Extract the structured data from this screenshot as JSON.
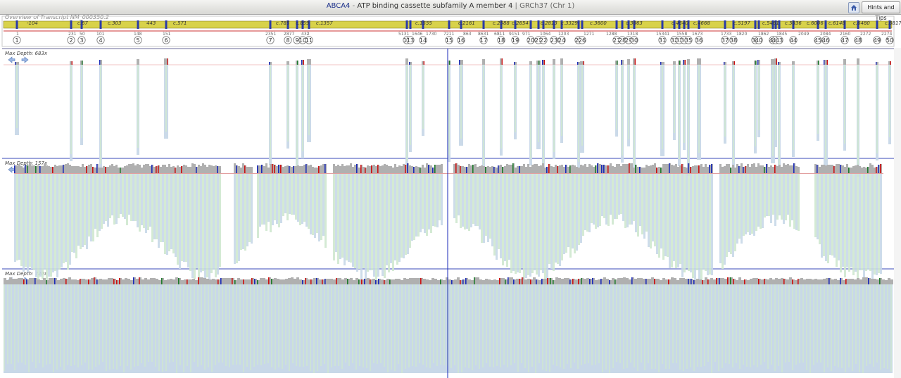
{
  "header": {
    "gene_symbol": "ABCA4",
    "gene_separator": " - ",
    "gene_name": "ATP binding cassette subfamily A member 4",
    "divider": " | ",
    "genome_build": "GRCh37 (Chr 1)",
    "hints_label": "Hints and Tips",
    "home_icon": "home-icon"
  },
  "overview": {
    "label": "Overview of Transcript NM_000350.2",
    "cdna_labels": [
      "-104",
      "c.67",
      "c.303",
      "443",
      "c.571",
      "c.785",
      "c.859",
      "c.1357",
      "c.1555",
      "c.2161",
      "c.2588",
      "c.2654",
      "c.2813",
      "c.3329",
      "c.3600",
      "c.3863",
      "c.4540",
      "c.4668",
      "c.5197",
      "c.5461",
      "c.5836",
      "c.6006",
      "c.6148",
      "c.6480",
      "c.6817"
    ],
    "coord_labels": [
      "1",
      "231",
      "50",
      "101",
      "148",
      "151",
      "2351",
      "2877",
      "432",
      "1",
      "5131",
      "1646",
      "1730",
      "7211",
      "863",
      "8631",
      "6811",
      "9151",
      "971",
      "1064",
      "1203",
      "1271",
      "1288",
      "1318",
      "15341",
      "1558",
      "1673",
      "1733",
      "1820",
      "1862",
      "1845",
      "2049",
      "2084",
      "2160",
      "2272",
      "2274"
    ],
    "exons": [
      "1",
      "2",
      "3",
      "4",
      "5",
      "6",
      "7",
      "8",
      "9",
      "10",
      "11",
      "12",
      "13",
      "14",
      "15",
      "16",
      "17",
      "18",
      "19",
      "20",
      "21",
      "22",
      "23",
      "24",
      "25",
      "26",
      "27",
      "28",
      "29",
      "30",
      "31",
      "32",
      "33",
      "34",
      "35",
      "36",
      "37",
      "38",
      "39",
      "40",
      "41",
      "42",
      "43",
      "44",
      "45",
      "46",
      "47",
      "48",
      "49",
      "50"
    ]
  },
  "tracks": [
    {
      "max_depth_label": "Max Depth: 683x"
    },
    {
      "max_depth_label": "Max Depth: 157x"
    },
    {
      "max_depth_label": "Max Depth: 720x"
    }
  ],
  "colors": {
    "exon_bar": "#d8d24a",
    "exon_mark": "#2a3aa8",
    "coverage": "#c8d8e8",
    "coverage_alt": "#cfe8cf",
    "depth_bar": "#b0b0b0",
    "snv_red": "#cc1010",
    "snv_blue": "#1a2ab8",
    "snv_green": "#1d7a2a",
    "cursor": "#1a2ab8"
  }
}
